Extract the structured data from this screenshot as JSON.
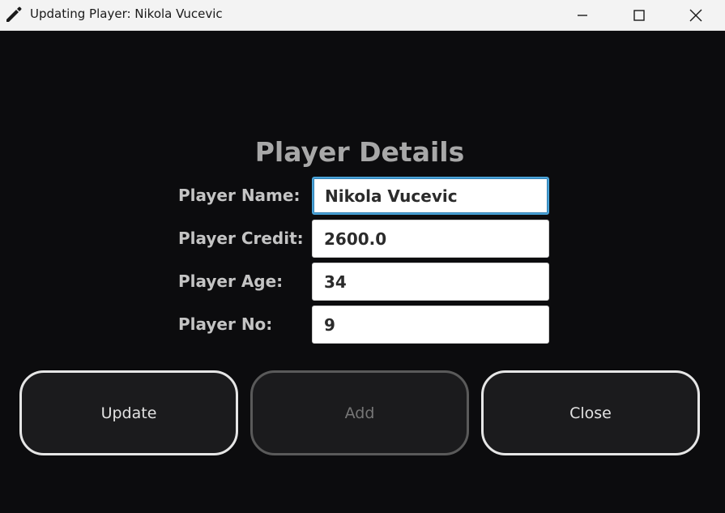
{
  "window": {
    "title": "Updating Player: Nikola Vucevic",
    "icon": "pencil-icon",
    "controls": [
      "minimize-icon",
      "maximize-icon",
      "close-icon"
    ]
  },
  "form": {
    "heading": "Player Details",
    "fields": [
      {
        "label": "Player Name:",
        "value": "Nikola Vucevic",
        "focused": true
      },
      {
        "label": "Player Credit:",
        "value": "2600.0",
        "focused": false
      },
      {
        "label": "Player Age:",
        "value": "34",
        "focused": false
      },
      {
        "label": "Player No:",
        "value": "9",
        "focused": false
      }
    ]
  },
  "buttons": {
    "update": {
      "label": "Update",
      "enabled": true
    },
    "add": {
      "label": "Add",
      "enabled": false
    },
    "close": {
      "label": "Close",
      "enabled": true
    }
  }
}
